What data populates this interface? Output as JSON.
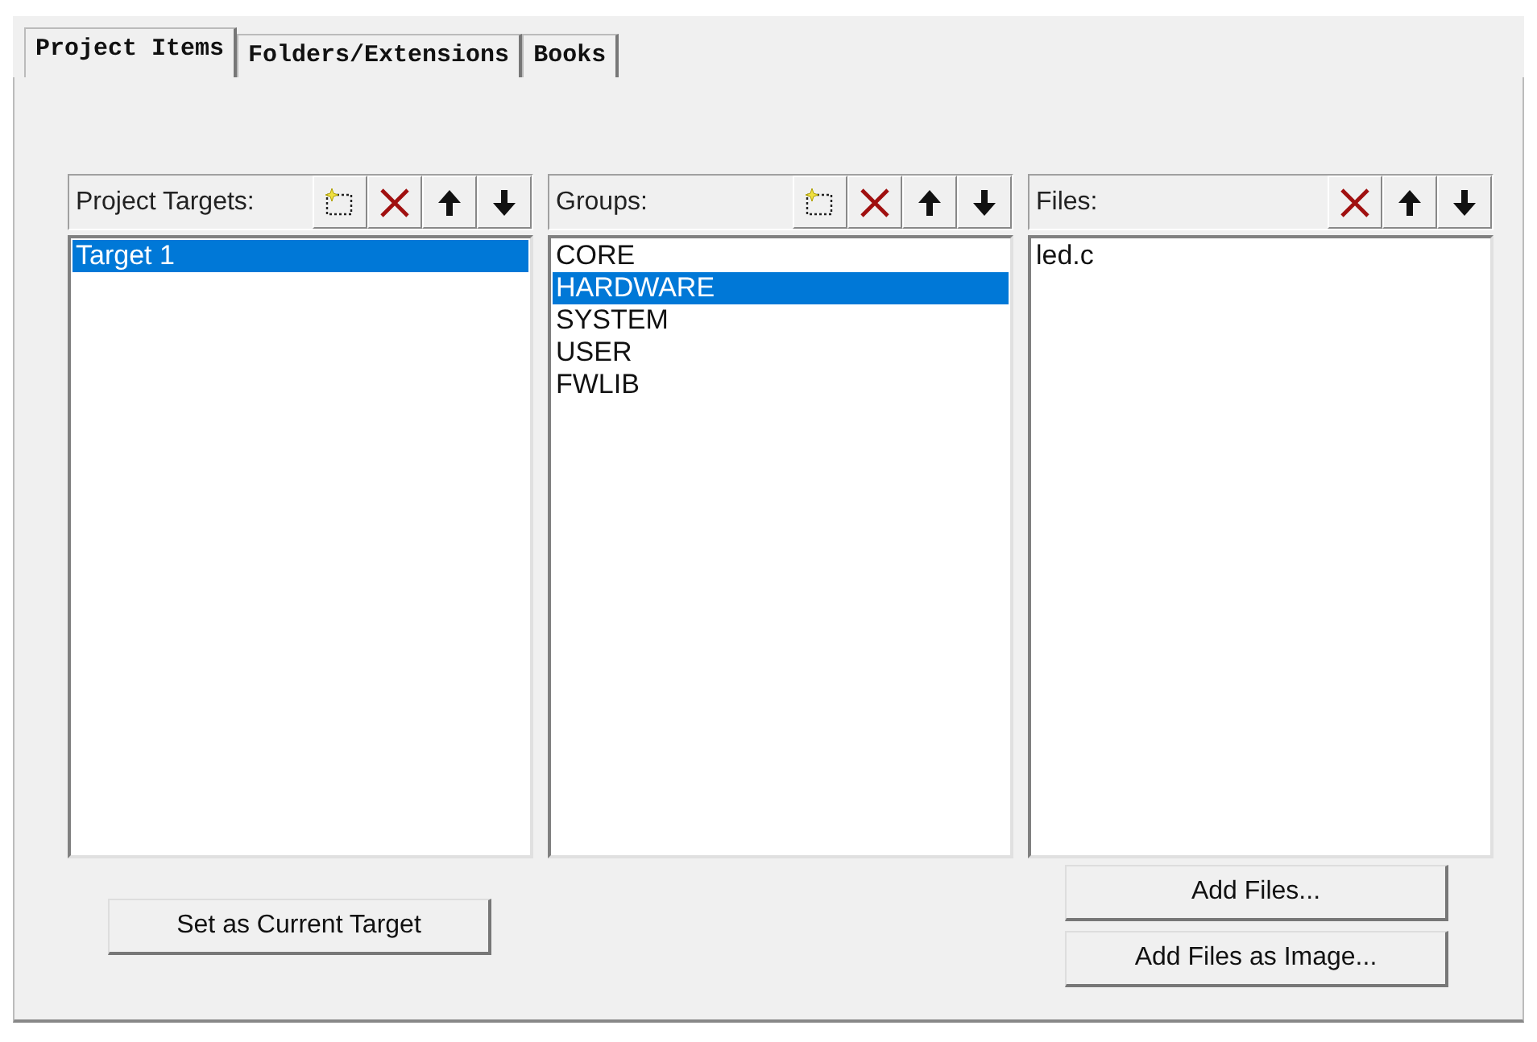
{
  "tabs": [
    {
      "label": "Project Items",
      "selected": true
    },
    {
      "label": "Folders/Extensions",
      "selected": false
    },
    {
      "label": "Books",
      "selected": false
    }
  ],
  "panels": [
    {
      "title": "Project Targets:",
      "tools": [
        {
          "kind": "new"
        },
        {
          "kind": "delete"
        },
        {
          "kind": "up"
        },
        {
          "kind": "down"
        }
      ],
      "items": [
        {
          "label": "Target 1",
          "selected": true
        }
      ]
    },
    {
      "title": "Groups:",
      "tools": [
        {
          "kind": "new"
        },
        {
          "kind": "delete"
        },
        {
          "kind": "up"
        },
        {
          "kind": "down"
        }
      ],
      "items": [
        {
          "label": "CORE",
          "selected": false
        },
        {
          "label": "HARDWARE",
          "selected": true
        },
        {
          "label": "SYSTEM",
          "selected": false
        },
        {
          "label": "USER",
          "selected": false
        },
        {
          "label": "FWLIB",
          "selected": false
        }
      ]
    },
    {
      "title": "Files:",
      "tools": [
        {
          "kind": "delete"
        },
        {
          "kind": "up"
        },
        {
          "kind": "down"
        }
      ],
      "items": [
        {
          "label": "led.c",
          "selected": false
        }
      ]
    }
  ],
  "buttons": {
    "left": [
      "Set as Current Target"
    ],
    "right": [
      "Add Files...",
      "Add Files as Image..."
    ]
  }
}
